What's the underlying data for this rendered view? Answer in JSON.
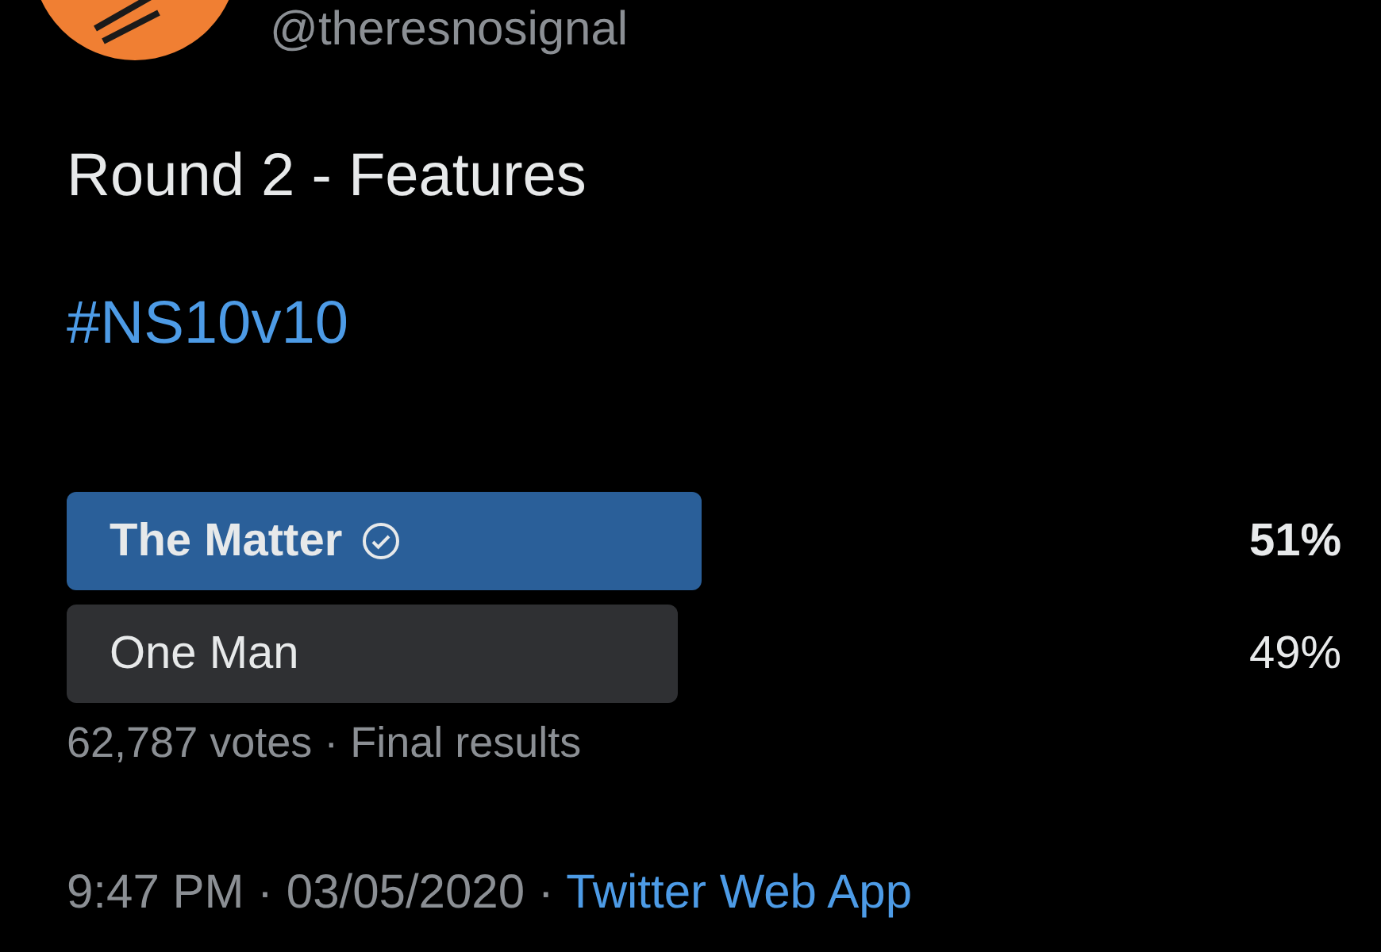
{
  "tweet": {
    "handle": "@theresnosignal",
    "text": "Round 2 - Features",
    "hashtag": "#NS10v10"
  },
  "poll": {
    "options": [
      {
        "label": "The Matter",
        "selected": true,
        "percent": "51%"
      },
      {
        "label": "One Man",
        "selected": false,
        "percent": "49%"
      }
    ],
    "summary": "62,787 votes · Final results"
  },
  "footer": {
    "timestamp": "9:47 PM · 03/05/2020 · ",
    "source": "Twitter Web App"
  }
}
